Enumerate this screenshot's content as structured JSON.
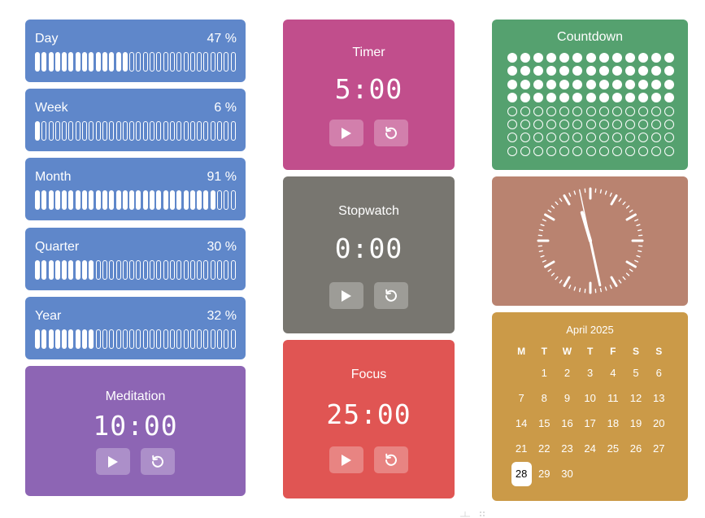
{
  "progress": [
    {
      "label": "Day",
      "percent_text": "47 %",
      "filled": 14,
      "total": 30
    },
    {
      "label": "Week",
      "percent_text": "6 %",
      "filled": 1,
      "total": 30
    },
    {
      "label": "Month",
      "percent_text": "91 %",
      "filled": 27,
      "total": 30
    },
    {
      "label": "Quarter",
      "percent_text": "30 %",
      "filled": 9,
      "total": 30
    },
    {
      "label": "Year",
      "percent_text": "32 %",
      "filled": 9,
      "total": 30
    }
  ],
  "timers": {
    "timer": {
      "title": "Timer",
      "time": "5:00"
    },
    "stopwatch": {
      "title": "Stopwatch",
      "time": "0:00"
    },
    "focus": {
      "title": "Focus",
      "time": "25:00"
    },
    "meditation": {
      "title": "Meditation",
      "time": "10:00"
    }
  },
  "countdown": {
    "title": "Countdown",
    "filled": 52,
    "total": 104
  },
  "clock": {
    "hour": 11,
    "minute": 27,
    "second": 58
  },
  "calendar": {
    "month": "April 2025",
    "weekdays": [
      "M",
      "T",
      "W",
      "T",
      "F",
      "S",
      "S"
    ],
    "first_weekday_offset": 1,
    "days": 30,
    "today": 28
  },
  "colors": {
    "progress": "#5f87ca",
    "timer": "#c14e8c",
    "stopwatch": "#787670",
    "focus": "#e05553",
    "meditation": "#8d65b4",
    "countdown": "#55a16f",
    "clock": "#b98370",
    "calendar": "#cb9a48"
  },
  "icons": {
    "play": "play-icon",
    "reset": "reset-icon",
    "grip": "grip-icon"
  }
}
